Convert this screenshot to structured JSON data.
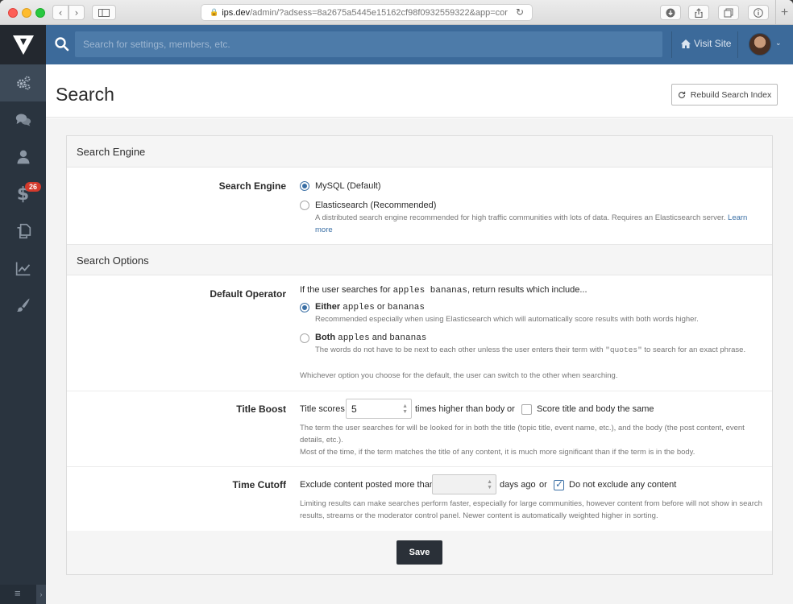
{
  "browser": {
    "url_host": "ips.dev",
    "url_path": "/admin/?adsess=8a2675a5445e15162cf98f0932559322&app=cor"
  },
  "sidebar": {
    "badge_count": "26",
    "items": [
      {
        "icon": "gears-icon"
      },
      {
        "icon": "comments-icon"
      },
      {
        "icon": "user-icon"
      },
      {
        "icon": "dollar-icon"
      },
      {
        "icon": "copy-icon"
      },
      {
        "icon": "chart-icon"
      },
      {
        "icon": "brush-icon"
      }
    ]
  },
  "header": {
    "search_placeholder": "Search for settings, members, etc.",
    "visit_site": "Visit Site"
  },
  "page": {
    "title": "Search",
    "rebuild_button": "Rebuild Search Index"
  },
  "sections": {
    "engine_title": "Search Engine",
    "options_title": "Search Options"
  },
  "engine": {
    "label": "Search Engine",
    "mysql": "MySQL (Default)",
    "elastic": "Elasticsearch (Recommended)",
    "elastic_desc": "A distributed search engine recommended for high traffic communities with lots of data. Requires an Elasticsearch server.",
    "learn_more": "Learn more",
    "selected": "mysql"
  },
  "operator": {
    "label": "Default Operator",
    "intro_pre": "If the user searches for",
    "intro_term": "apples bananas",
    "intro_post": ", return results which include...",
    "either_bold": "Either",
    "either_a": "apples",
    "either_or": "or",
    "either_b": "bananas",
    "either_desc": "Recommended especially when using Elasticsearch which will automatically score results with both words higher.",
    "both_bold": "Both",
    "both_a": "apples",
    "both_and": "and",
    "both_b": "bananas",
    "both_desc_pre": "The words do not have to be next to each other unless the user enters their term with",
    "both_desc_term": "\"quotes\"",
    "both_desc_post": "to search for an exact phrase.",
    "footer": "Whichever option you choose for the default, the user can switch to the other when searching.",
    "selected": "either"
  },
  "title_boost": {
    "label": "Title Boost",
    "prefix": "Title scores",
    "value": "5",
    "suffix": "times higher than body",
    "or": "or",
    "checkbox_label": "Score title and body the same",
    "checkbox_checked": false,
    "desc1": "The term the user searches for will be looked for in both the title (topic title, event name, etc.), and the body (the post content, event details, etc.).",
    "desc2": "Most of the time, if the term matches the title of any content, it is much more significant than if the term is in the body."
  },
  "time_cutoff": {
    "label": "Time Cutoff",
    "prefix": "Exclude content posted more than",
    "value": "",
    "suffix": "days ago",
    "or": "or",
    "checkbox_label": "Do not exclude any content",
    "checkbox_checked": true,
    "desc": "Limiting results can make searches perform faster, especially for large communities, however content from before will not show in search results, streams or the moderator control panel. Newer content is automatically weighted higher in sorting."
  },
  "save_label": "Save"
}
